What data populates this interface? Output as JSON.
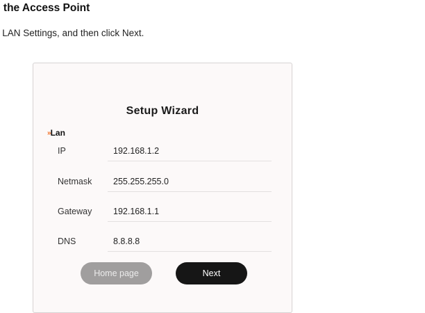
{
  "heading": "e the Access Point",
  "instruction": "n LAN Settings, and then click Next.",
  "wizard": {
    "title": "Setup Wizard",
    "section_label": "Lan",
    "section_marker": "»",
    "fields": [
      {
        "label": "IP",
        "value": "192.168.1.2"
      },
      {
        "label": "Netmask",
        "value": "255.255.255.0"
      },
      {
        "label": "Gateway",
        "value": "192.168.1.1"
      },
      {
        "label": "DNS",
        "value": "8.8.8.8"
      }
    ],
    "buttons": {
      "home": "Home page",
      "next": "Next"
    }
  },
  "colors": {
    "accent": "#ef6a1f",
    "next_button": "#161616",
    "home_button": "#a09e9e"
  }
}
